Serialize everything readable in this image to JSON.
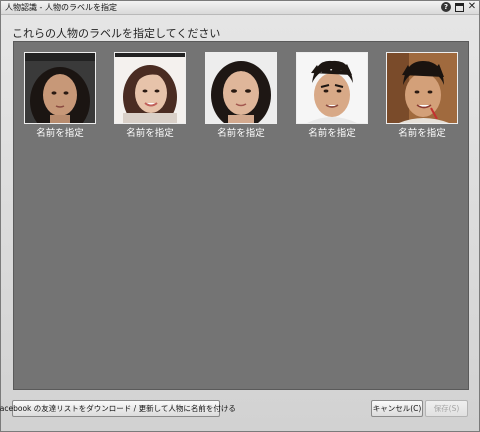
{
  "window": {
    "title": "人物認識 - 人物のラベルを指定"
  },
  "instruction": "これらの人物のラベルを指定してください",
  "faces": [
    {
      "label": "名前を指定"
    },
    {
      "label": "名前を指定"
    },
    {
      "label": "名前を指定"
    },
    {
      "label": "名前を指定"
    },
    {
      "label": "名前を指定"
    }
  ],
  "footer": {
    "facebook_label": "Facebook の友達リストをダウンロード / 更新して人物に名前を付ける",
    "cancel_label": "キャンセル(C)",
    "save_label": "保存(S)"
  }
}
